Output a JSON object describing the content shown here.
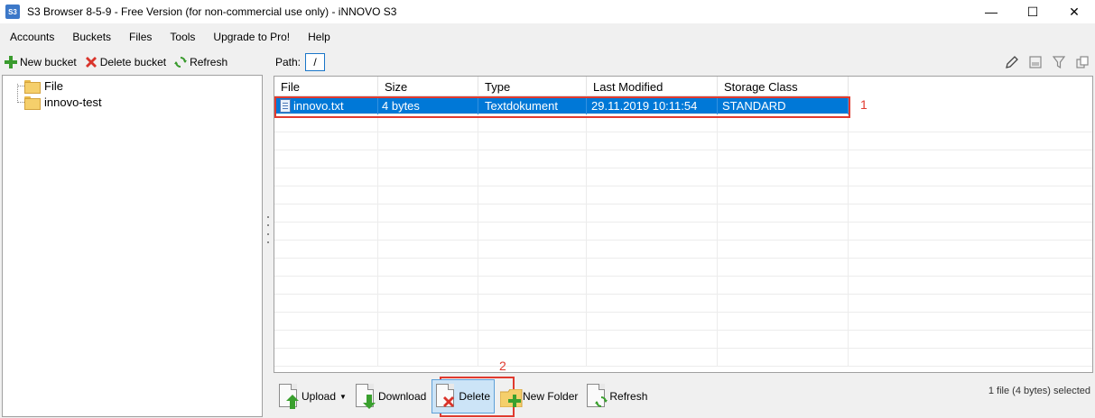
{
  "window": {
    "title": "S3 Browser 8-5-9 - Free Version (for non-commercial use only) - iNNOVO S3",
    "app_icon_text": "S3",
    "minimize": "—",
    "maximize": "☐",
    "close": "✕"
  },
  "menu": [
    "Accounts",
    "Buckets",
    "Files",
    "Tools",
    "Upgrade to Pro!",
    "Help"
  ],
  "left_toolbar": {
    "new_bucket": "New bucket",
    "delete_bucket": "Delete bucket",
    "refresh": "Refresh"
  },
  "tree": {
    "items": [
      "File",
      "innovo-test"
    ]
  },
  "path": {
    "label": "Path:",
    "value": "/"
  },
  "grid": {
    "columns": [
      "File",
      "Size",
      "Type",
      "Last Modified",
      "Storage Class"
    ],
    "rows": [
      {
        "file": "innovo.txt",
        "size": "4 bytes",
        "type": "Textdokument",
        "modified": "29.11.2019 10:11:54",
        "storage": "STANDARD"
      }
    ]
  },
  "annotations": {
    "one": "1",
    "two": "2"
  },
  "bottom_toolbar": {
    "upload": "Upload",
    "download": "Download",
    "delete": "Delete",
    "new_folder": "New Folder",
    "refresh": "Refresh"
  },
  "status": "1 file (4 bytes) selected",
  "colors": {
    "selection": "#0078d7",
    "annotation": "#e03a2f",
    "folder": "#f5cf6b"
  }
}
